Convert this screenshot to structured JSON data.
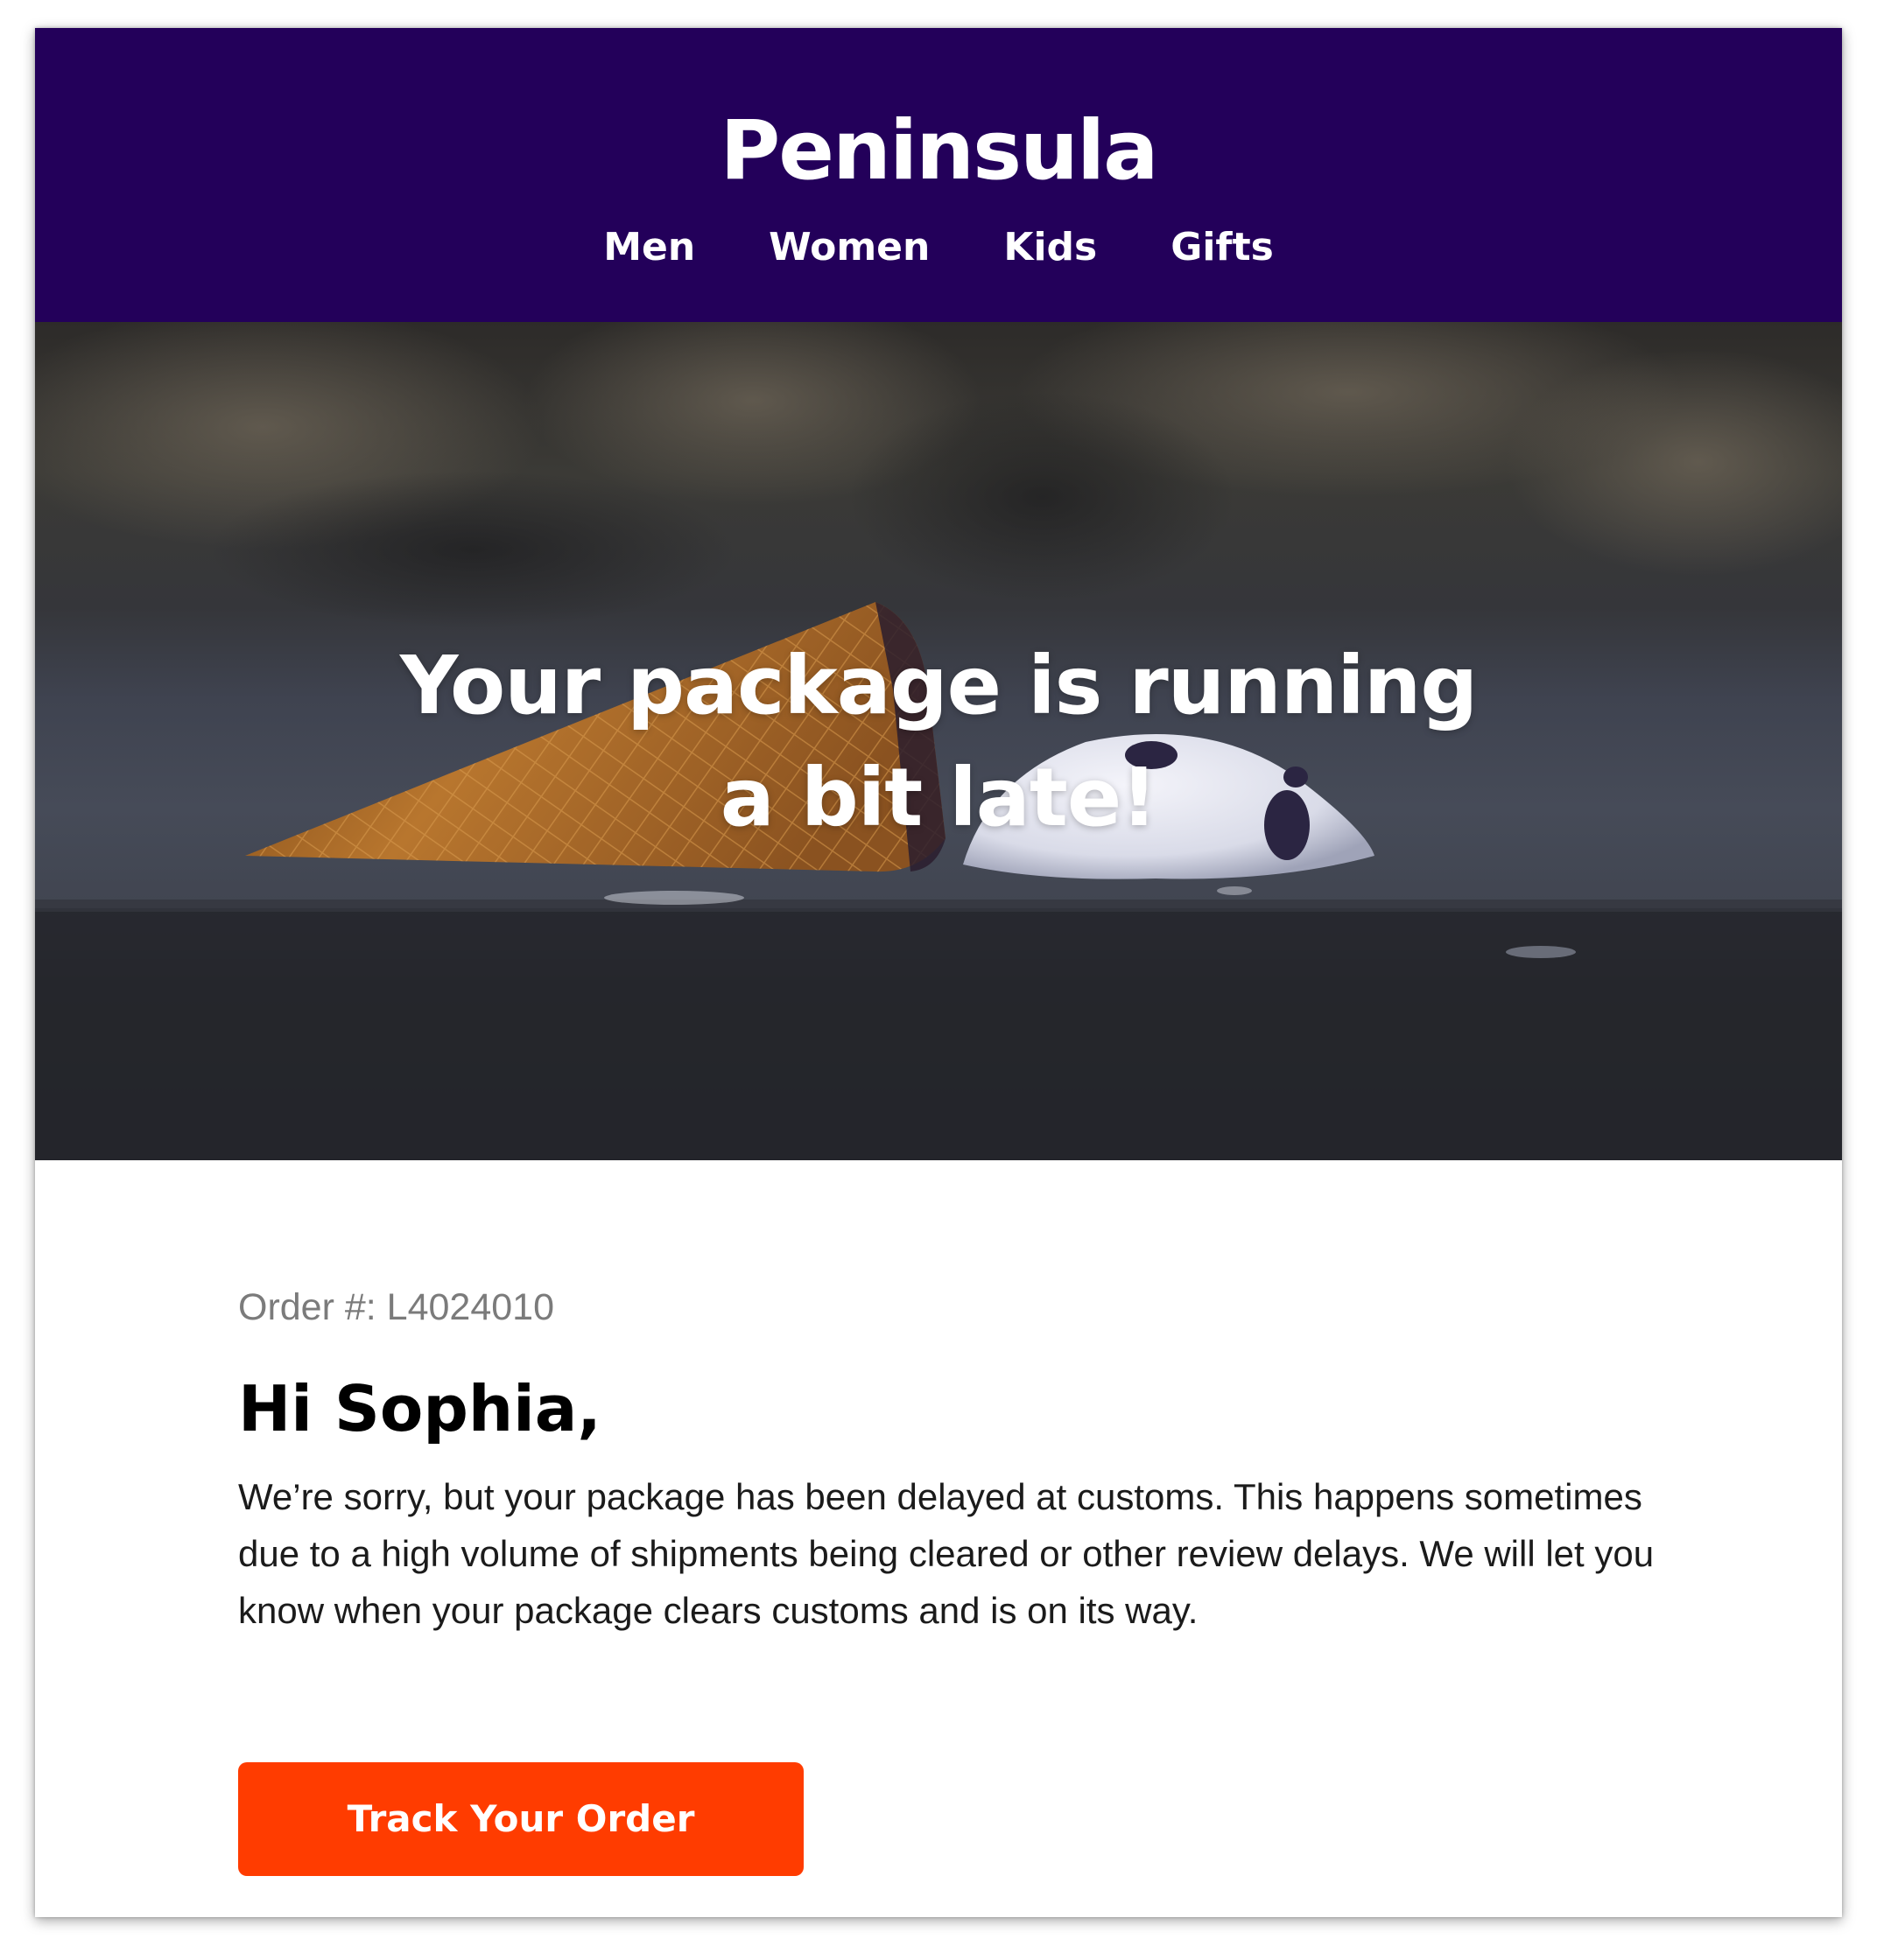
{
  "header": {
    "brand": "Peninsula",
    "nav": [
      {
        "label": "Men"
      },
      {
        "label": "Women"
      },
      {
        "label": "Kids"
      },
      {
        "label": "Gifts"
      }
    ]
  },
  "hero": {
    "image": "dropped-ice-cream-cone-photo",
    "title_line1": "Your package is running",
    "title_line2": "a bit late!"
  },
  "content": {
    "order_number": "Order #: L4024010",
    "greeting": "Hi Sophia,",
    "message": "We’re sorry, but your package has been delayed at customs. This happens sometimes due to a high volume of shipments being cleared or other review delays. We will let you know when your package clears customs and is on its way.",
    "cta_label": "Track Your Order"
  },
  "colors": {
    "header_bg": "#23005a",
    "cta_bg": "#ff3c00",
    "text": "#1b1b1b",
    "muted": "#7b7b7b"
  }
}
